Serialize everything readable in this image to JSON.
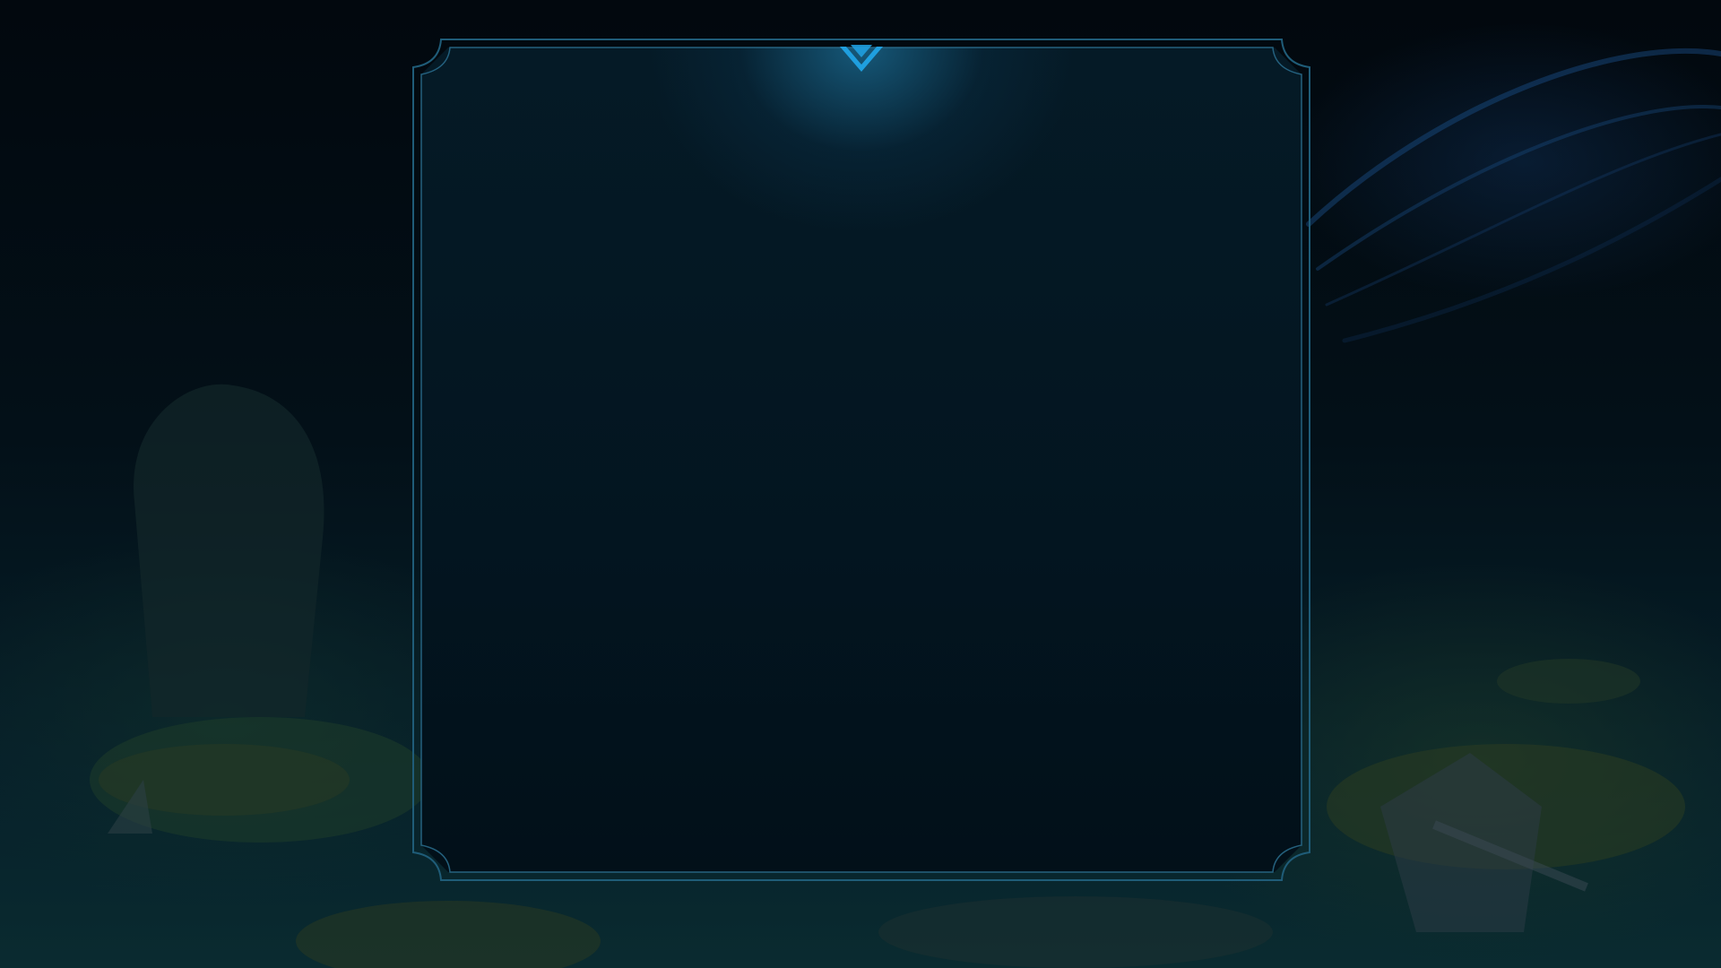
{
  "screen": {
    "name": "game-modal-overlay",
    "background_theme": "dark-ocean-islands",
    "colors": {
      "accent": "#1f9fdf",
      "frame_line": "#2a6f8f",
      "panel_bg": "#031520"
    }
  },
  "modal": {
    "content_state": "empty",
    "decoration_icon": "chevron-down-icon"
  }
}
